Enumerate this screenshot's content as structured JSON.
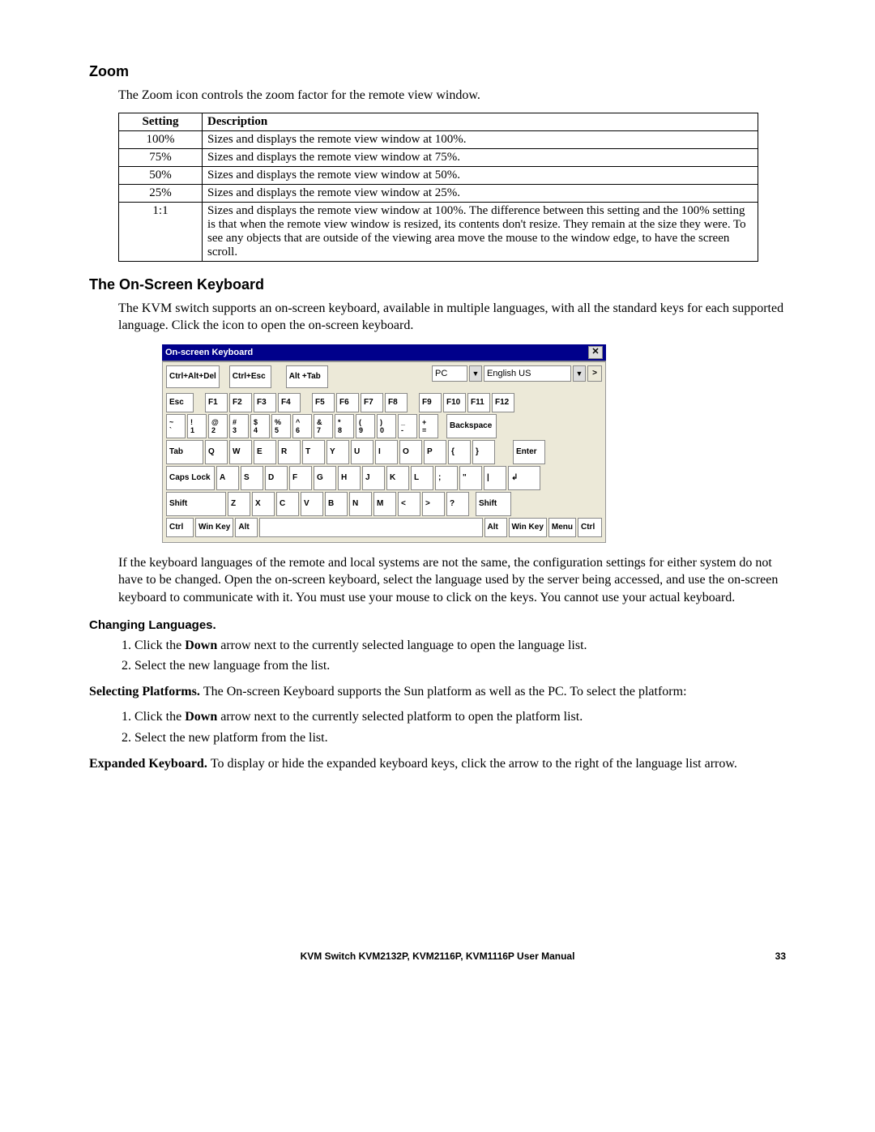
{
  "zoom": {
    "heading": "Zoom",
    "intro": "The Zoom icon controls the zoom factor for the remote view window.",
    "headers": {
      "setting": "Setting",
      "description": "Description"
    },
    "rows": [
      {
        "s": "100%",
        "d": "Sizes and displays the remote view window at 100%."
      },
      {
        "s": "75%",
        "d": "Sizes and displays the remote view window at 75%."
      },
      {
        "s": "50%",
        "d": "Sizes and displays the remote view window at 50%."
      },
      {
        "s": "25%",
        "d": "Sizes and displays the remote view window at 25%."
      },
      {
        "s": "1:1",
        "d": "Sizes and displays the remote view window at 100%. The difference between this setting and the 100% setting is that when the remote view window is resized, its contents don't resize. They remain at the size they were. To see any objects that are outside of the viewing area move the mouse to the window edge, to have the screen scroll."
      }
    ]
  },
  "osk": {
    "heading": "The On-Screen Keyboard",
    "intro": "The KVM switch supports an on-screen keyboard, available in multiple languages, with all the standard keys for each supported language. Click the icon to open the on-screen keyboard.",
    "title": "On-screen Keyboard",
    "close_icon": "✕",
    "top_buttons": {
      "cad": "Ctrl+Alt+Del",
      "ce": "Ctrl+Esc",
      "at": "Alt +Tab"
    },
    "platform": "PC",
    "language": "English US",
    "expand_arrow": ">",
    "fkeys": [
      "Esc",
      "F1",
      "F2",
      "F3",
      "F4",
      "F5",
      "F6",
      "F7",
      "F8",
      "F9",
      "F10",
      "F11",
      "F12"
    ],
    "numrow": [
      [
        "~",
        "`"
      ],
      [
        "!",
        "1"
      ],
      [
        "@",
        "2"
      ],
      [
        "#",
        "3"
      ],
      [
        "$",
        "4"
      ],
      [
        "%",
        "5"
      ],
      [
        "^",
        "6"
      ],
      [
        "&",
        "7"
      ],
      [
        "*",
        "8"
      ],
      [
        "(",
        "9"
      ],
      [
        ")",
        "0"
      ],
      [
        "_",
        "-"
      ],
      [
        "+",
        "="
      ]
    ],
    "backspace": "Backspace",
    "tab": "Tab",
    "qrow": [
      "Q",
      "W",
      "E",
      "R",
      "T",
      "Y",
      "U",
      "I",
      "O",
      "P",
      "{",
      "}"
    ],
    "enter": "Enter",
    "caps": "Caps Lock",
    "arow": [
      "A",
      "S",
      "D",
      "F",
      "G",
      "H",
      "J",
      "K",
      "L",
      ";",
      "\"",
      "|"
    ],
    "shift": "Shift",
    "zrow": [
      "Z",
      "X",
      "C",
      "V",
      "B",
      "N",
      "M",
      "<",
      ">",
      "?"
    ],
    "bottom": [
      "Ctrl",
      "Win Key",
      "Alt",
      "Alt",
      "Win Key",
      "Menu",
      "Ctrl"
    ],
    "after": "If the keyboard languages of the remote and local systems are not the same, the configuration settings for either system do not have to be changed. Open the on-screen keyboard, select the language used by the server being accessed, and use the on-screen keyboard to communicate with it. You must use your mouse to click on the keys. You cannot use your actual keyboard."
  },
  "changing_lang": {
    "heading": "Changing Languages.",
    "steps_pre": [
      "Click the ",
      "Select the new language from the list."
    ],
    "bold1": "Down",
    "post1": " arrow next to the currently selected language to open the language list."
  },
  "platforms": {
    "heading": "Selecting Platforms. ",
    "text": "The On-screen Keyboard supports the Sun platform as well as the PC. To select the platform:",
    "steps_pre": [
      "Click the ",
      "Select the new platform from the list."
    ],
    "bold1": "Down",
    "post1": " arrow next to the currently selected platform to open the platform list."
  },
  "expanded": {
    "heading": "Expanded Keyboard. ",
    "text": "To display or hide the expanded keyboard keys, click the arrow to the right of the language list arrow."
  },
  "footer": {
    "title": "KVM Switch KVM2132P, KVM2116P, KVM1116P User Manual",
    "page": "33"
  }
}
